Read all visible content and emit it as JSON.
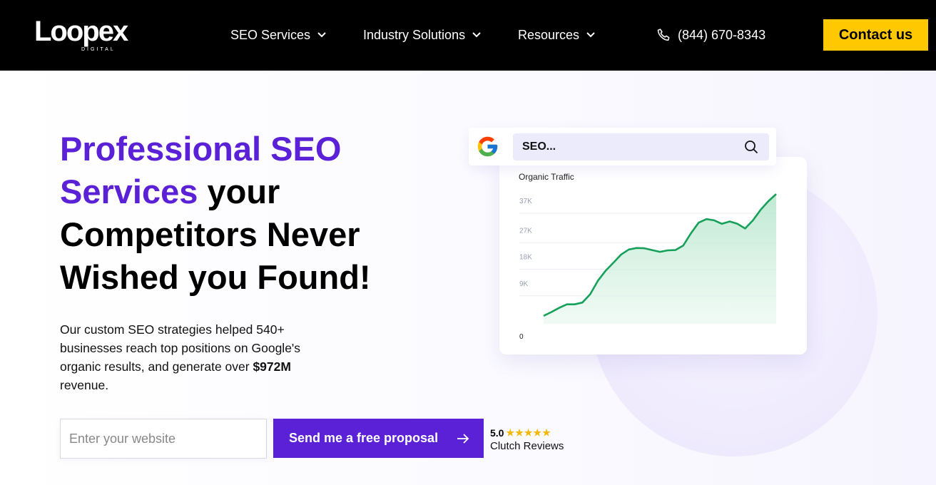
{
  "header": {
    "logo_text": "Loopex",
    "logo_sub": "DIGITAL",
    "nav": [
      {
        "label": "SEO Services"
      },
      {
        "label": "Industry Solutions"
      },
      {
        "label": "Resources"
      }
    ],
    "phone": "(844) 670-8343",
    "contact_label": "Contact us",
    "accent_color": "#ffc800"
  },
  "hero": {
    "headline_accent": "Professional SEO Services",
    "headline_rest": " your Competitors Never Wished you Found!",
    "sub_before": "Our custom SEO strategies helped 540+ businesses reach top positions on Google's organic results, and generate over ",
    "sub_bold": "$972M",
    "sub_after": " revenue.",
    "input_placeholder": "Enter your website",
    "button_label": "Send me a free proposal",
    "rating_score": "5.0",
    "rating_stars": "★★★★★",
    "rating_label": "Clutch Reviews",
    "brand_color": "#5b21d6"
  },
  "search": {
    "query": "SEO..."
  },
  "chart_data": {
    "type": "area",
    "title": "Organic Traffic",
    "yticks": [
      "37K",
      "27K",
      "18K",
      "9K",
      "0"
    ],
    "ylim": [
      0,
      37000
    ],
    "x": [
      0,
      1,
      2,
      3,
      4,
      5,
      6,
      7,
      8,
      9,
      10,
      11,
      12,
      13,
      14,
      15,
      16,
      17,
      18,
      19,
      20,
      21,
      22,
      23,
      24,
      25,
      26,
      27,
      28,
      29,
      30,
      31,
      32,
      33,
      34,
      35,
      36,
      37,
      38,
      39,
      40
    ],
    "values": [
      2700,
      4000,
      5400,
      6600,
      6600,
      7200,
      10000,
      14600,
      18000,
      20700,
      23500,
      25200,
      25700,
      25600,
      25000,
      24400,
      24900,
      25000,
      26500,
      30700,
      34300,
      35500,
      35100,
      33900,
      34700,
      33900,
      32300,
      35100,
      38700,
      41600,
      44000
    ],
    "series": [
      {
        "name": "Organic Traffic"
      }
    ],
    "grid": true,
    "line_color": "#16a05a",
    "fill_color": "#cdeedb"
  }
}
